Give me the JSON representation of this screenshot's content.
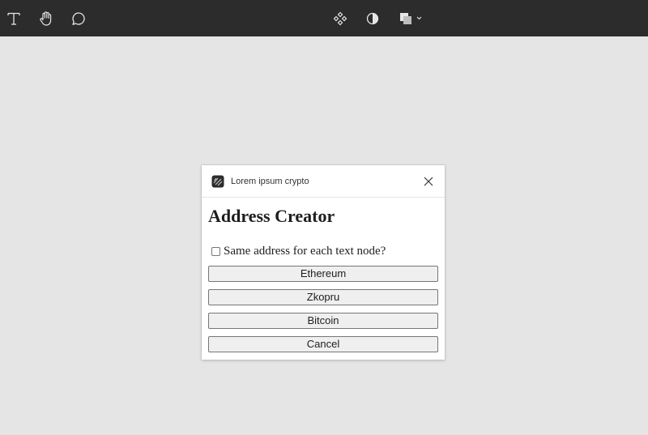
{
  "toolbar": {
    "tools": [
      {
        "icon": "text-tool-icon"
      },
      {
        "icon": "hand-tool-icon"
      },
      {
        "icon": "comment-tool-icon"
      }
    ],
    "right_tools": [
      {
        "icon": "component-icon"
      },
      {
        "icon": "contrast-icon"
      },
      {
        "icon": "boolean-shapes-icon"
      }
    ],
    "colors": {
      "background": "#2c2c2c",
      "icon": "#e6e6e6"
    }
  },
  "dialog": {
    "plugin_name": "Lorem ipsum crypto",
    "heading": "Address Creator",
    "checkbox": {
      "label": "Same address for each text node?",
      "checked": false
    },
    "buttons": {
      "ethereum": "Ethereum",
      "zkopru": "Zkopru",
      "bitcoin": "Bitcoin",
      "cancel": "Cancel"
    }
  }
}
